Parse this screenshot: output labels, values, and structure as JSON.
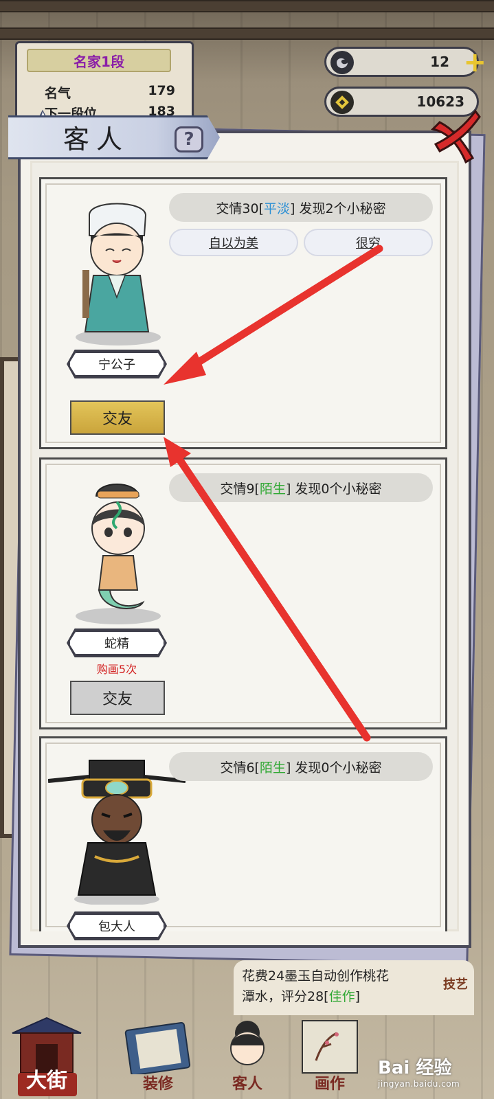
{
  "rank": {
    "title": "名家1段",
    "fame_label": "名气",
    "fame_value": "179",
    "next_label": "下一段位",
    "next_value": "183"
  },
  "resources": {
    "ink_jade": "12",
    "coins": "10623"
  },
  "dialog": {
    "title": "客人",
    "help_label": "?"
  },
  "guests": [
    {
      "name": "宁公子",
      "affinity_prefix": "交情30[",
      "affinity_level": "平淡",
      "affinity_suffix": "] 发现2个小秘密",
      "traits": [
        "自以为美",
        "很穷"
      ],
      "action_label": "交友"
    },
    {
      "name": "蛇精",
      "affinity_prefix": "交情9[",
      "affinity_level": "陌生",
      "affinity_suffix": "] 发现0个小秘密",
      "buy_count": "购画5次",
      "action_label": "交友"
    },
    {
      "name": "包大人",
      "affinity_prefix": "交情6[",
      "affinity_level": "陌生",
      "affinity_suffix": "] 发现0个小秘密"
    }
  ],
  "log": {
    "line1": "花费24墨玉自动创作桃花",
    "line2_prefix": "潭水，评分28[",
    "line2_highlight": "佳作",
    "line2_suffix": "]",
    "skill_tag": "技艺"
  },
  "nav": {
    "street": "大街",
    "decorate": "装修",
    "guests": "客人",
    "paint": "画作"
  },
  "watermark": {
    "brand": "Bai 经验",
    "url": "jingyan.baidu.com"
  },
  "colors": {
    "affinity_plain": "#2b8fd4",
    "affinity_stranger": "#2fa833",
    "buy_count": "#d32222",
    "annotation_arrow": "#e8332e"
  }
}
